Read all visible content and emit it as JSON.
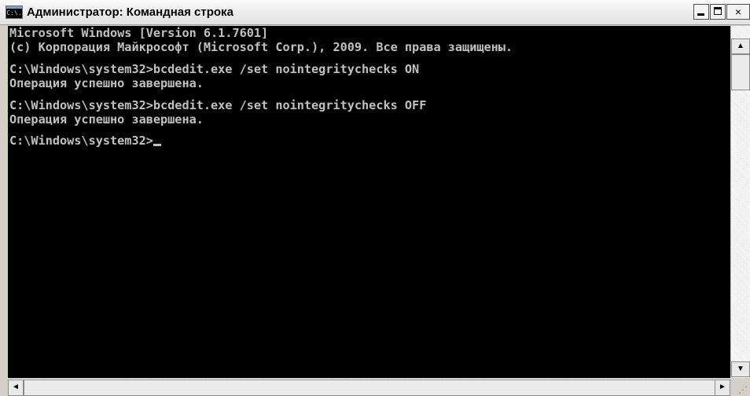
{
  "window": {
    "title": "Администратор: Командная строка",
    "icon": "cmd-icon",
    "icon_text": "C:\\.",
    "controls": {
      "minimize": "minimize-icon",
      "maximize": "maximize-icon",
      "close": "close-icon",
      "close_glyph": "×"
    }
  },
  "console": {
    "lines": [
      "Microsoft Windows [Version 6.1.7601]",
      "(c) Корпорация Майкрософт (Microsoft Corp.), 2009. Все права защищены.",
      "C:\\Windows\\system32>bcdedit.exe /set nointegritychecks ON",
      "Операция успешно завершена.",
      "C:\\Windows\\system32>bcdedit.exe /set nointegritychecks OFF",
      "Операция успешно завершена.",
      "C:\\Windows\\system32>"
    ],
    "text_color": "#c0c0c0",
    "background": "#000000"
  },
  "scrollbars": {
    "up_arrow": "▲",
    "down_arrow": "▼",
    "left_arrow": "◄",
    "right_arrow": "►"
  }
}
